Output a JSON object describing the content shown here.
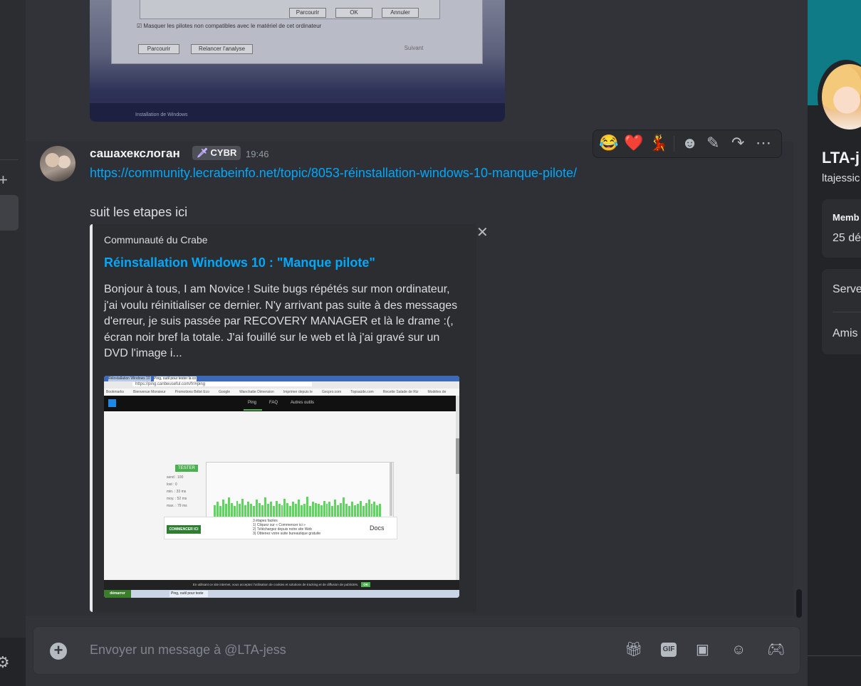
{
  "left_rail": {
    "add_icon": "plus",
    "settings_icon": "gear"
  },
  "prev_image": {
    "buttons": [
      "Parcourir",
      "OK",
      "Annuler"
    ],
    "checkbox_label": "Masquer les pilotes non compatibles avec le matériel de cet ordinateur",
    "lower_buttons": [
      "Parcourir",
      "Relancer l'analyse"
    ],
    "next_label": "Suivant",
    "footer_text": "Installation de Windows"
  },
  "message": {
    "author": "сашахекслоган",
    "tag": "CYBR",
    "tag_icon": "sword",
    "time": "19:46",
    "link": "https://community.lecrabeinfo.net/topic/8053-réinstallation-windows-10-manque-pilote/",
    "text": "suit les etapes ici"
  },
  "actions": {
    "reactions": [
      "😂",
      "❤️",
      "💃"
    ],
    "icons": [
      "add-reaction-icon",
      "edit-icon",
      "forward-icon",
      "more-icon"
    ]
  },
  "embed": {
    "provider": "Communauté du Crabe",
    "title": "Réinstallation Windows 10 : \"Manque pilote\"",
    "description": "Bonjour à tous, I am Novice ! Suite bugs répétés sur mon ordinateur, j'ai voulu réinitialiser ce dernier. N'y arrivant pas suite à des messages d'erreur, je suis passée par RECOVERY MANAGER et là le drame :(, écran noir bref la totale. J'ai fouillé sur le web et là j'ai gravé sur un DVD l'image i...",
    "close_glyph": "✕"
  },
  "embed_image": {
    "tab1": "Réinstallation Windows 10",
    "tab2": "Ping, outil pour tester la co",
    "url": "https://ping.canbeuseful.com/fr/#ping",
    "bookmarks": [
      "Bookmarks",
      "Bienvenue Monsieur",
      "Promotions Bébé Eco",
      "Google",
      "Wanchatte Dimension",
      "Imprimer depuis le",
      "Gecpro.com",
      "Topsaúde.com",
      "Recette Salade de Riz",
      "Modèles de Coloriage"
    ],
    "nav": [
      "Ping",
      "FAQ",
      "Autres outils"
    ],
    "test_button": "TESTER",
    "stats": [
      "send : 100",
      "lost : 0",
      "min. : 33 ms",
      "moy. : 52 ms",
      "max. : 79 ms"
    ],
    "ad_cta": "COMMENCER ICI",
    "ad_lines": [
      "3 étapes faciles",
      "1) Cliquez sur « Commencer ici »",
      "2) Téléchargez depuis notre site Web",
      "3) Obtenez votre suite bureautique gratuite"
    ],
    "ad_brand": "Docs",
    "cookie_text": "En utilisant ce site internet, vous acceptez l'utilisation de cookies et solutions de tracking et de diffusion de publicités.",
    "cookie_ok": "OK",
    "start": "démarrer",
    "taskbar_window": "Ping, outil pour teste",
    "bar_values": [
      0.55,
      0.7,
      0.5,
      0.8,
      0.6,
      0.9,
      0.65,
      0.5,
      0.75,
      0.6,
      0.85,
      0.55,
      0.7,
      0.6,
      0.5,
      0.8,
      0.65,
      0.55,
      0.9,
      0.6,
      0.7,
      0.5,
      0.75,
      0.6,
      0.55,
      0.85,
      0.65,
      0.5,
      0.7,
      0.6,
      0.8,
      0.55,
      0.6,
      0.95,
      0.5,
      0.7,
      0.65,
      0.6,
      0.55,
      0.75,
      0.6,
      0.7,
      0.5,
      0.8,
      0.55,
      0.65,
      0.9,
      0.6,
      0.5,
      0.7,
      0.55,
      0.6,
      0.75,
      0.5,
      0.65,
      0.8,
      0.6,
      0.7,
      0.55,
      0.6
    ]
  },
  "composer": {
    "placeholder": "Envoyer un message à @LTA-jess",
    "gif_label": "GIF",
    "icons": [
      "gift-icon",
      "gif-icon",
      "sticker-icon",
      "emoji-icon",
      "activity-icon"
    ]
  },
  "profile": {
    "display_name": "LTA-j",
    "username": "ltajessic",
    "member_label": "Memb",
    "member_since": "25 dé",
    "servers": "Serve",
    "friends": "Amis"
  }
}
